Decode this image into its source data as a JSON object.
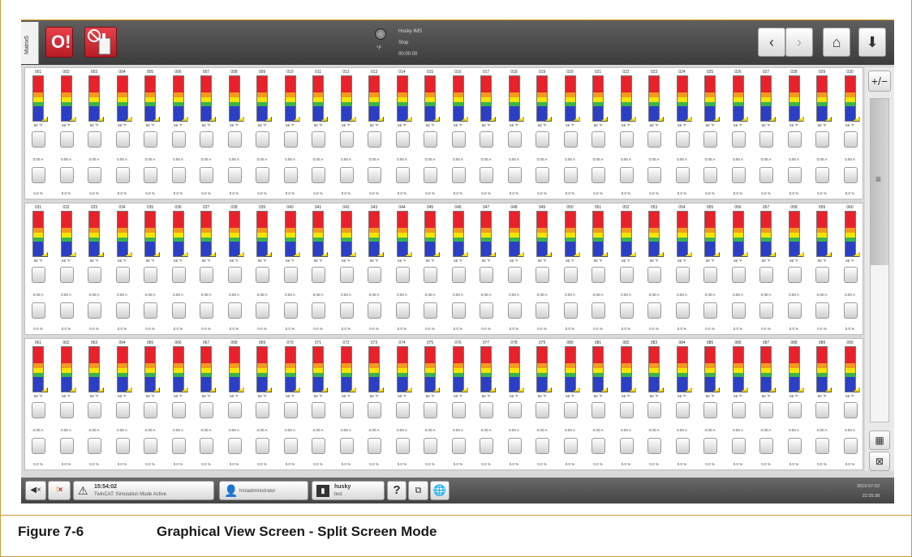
{
  "header": {
    "side_tab": "Matrix5",
    "status_lines": [
      "Husky IMS",
      "Stop",
      "00:00:00"
    ],
    "unit": "°F",
    "nav_back": "‹",
    "nav_forward": "›",
    "nav_home": "⌂",
    "nav_download": "⬇"
  },
  "zone_template": {
    "temp": "68 °F",
    "amps": "0.00 A",
    "pct": "0.0 %"
  },
  "sections": [
    {
      "start": 1,
      "count": 30
    },
    {
      "start": 31,
      "count": 30
    },
    {
      "start": 61,
      "count": 30
    }
  ],
  "sidebar": {
    "plus_minus": "+/−",
    "scroll_icon": "≡",
    "grid_icon": "▦",
    "close_grid_icon": "⊠"
  },
  "footer": {
    "msg_time": "15:54:02",
    "msg_text": "TwinCAT: Simulation Mode Active",
    "user": "hmiadministrator",
    "mold_name": "husky",
    "mold_sub": "test",
    "help": "?",
    "date": "2019-07-02",
    "time": "22:25:38"
  },
  "caption": {
    "number": "Figure 7-6",
    "title": "Graphical View Screen - Split Screen Mode"
  },
  "colors": {
    "red": "#e8212a",
    "orange": "#f39a1e",
    "yellow": "#f5e400",
    "green": "#39b54a",
    "blue": "#2b3fc4",
    "accent_gold": "#c89b3a"
  }
}
